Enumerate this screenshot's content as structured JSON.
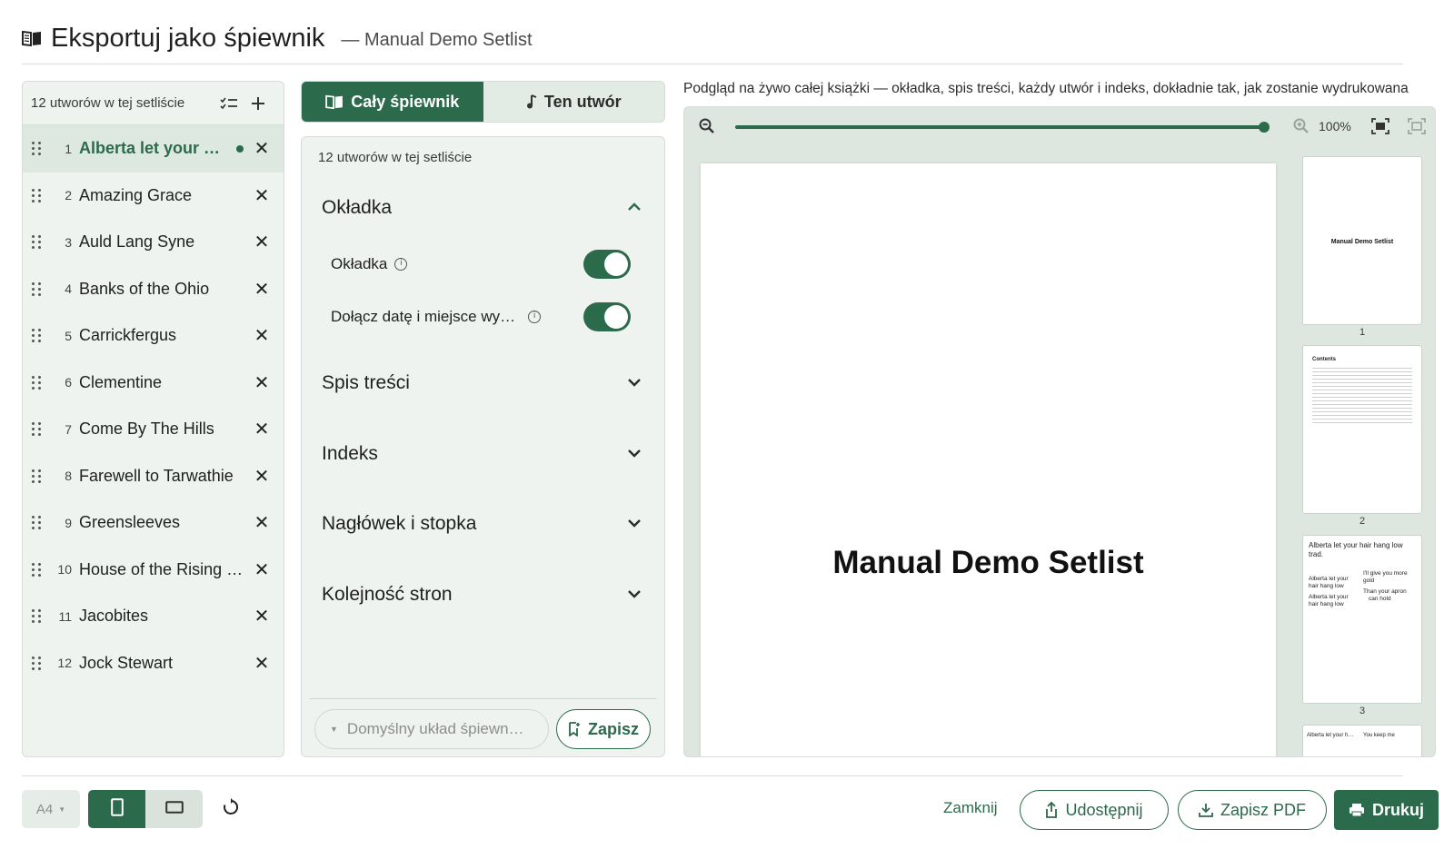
{
  "header": {
    "title": "Eksportuj jako śpiewnik",
    "subtitle": "— Manual Demo Setlist"
  },
  "setlist": {
    "count_label": "12 utworów w tej setliście",
    "songs": [
      {
        "num": "1",
        "name": "Alberta let your hair hang low",
        "active": true
      },
      {
        "num": "2",
        "name": "Amazing Grace"
      },
      {
        "num": "3",
        "name": "Auld Lang Syne"
      },
      {
        "num": "4",
        "name": "Banks of the Ohio"
      },
      {
        "num": "5",
        "name": "Carrickfergus"
      },
      {
        "num": "6",
        "name": "Clementine"
      },
      {
        "num": "7",
        "name": "Come By The Hills"
      },
      {
        "num": "8",
        "name": "Farewell to Tarwathie"
      },
      {
        "num": "9",
        "name": "Greensleeves"
      },
      {
        "num": "10",
        "name": "House of the Rising Sun"
      },
      {
        "num": "11",
        "name": "Jacobites"
      },
      {
        "num": "12",
        "name": "Jock Stewart"
      }
    ]
  },
  "tabs": {
    "whole_book": "Cały śpiewnik",
    "this_song": "Ten utwór"
  },
  "settings": {
    "count_label": "12 utworów w tej setliście",
    "cover_section": "Okładka",
    "cover_toggle_label": "Okładka",
    "date_toggle_label": "Dołącz datę i miejsce wy…",
    "cover_toggle_on": true,
    "date_toggle_on": true,
    "toc_section": "Spis treści",
    "index_section": "Indeks",
    "header_footer_section": "Nagłówek i stopka",
    "page_order_section": "Kolejność stron",
    "layout_placeholder": "Domyślny układ śpiewn…",
    "save_label": "Zapisz"
  },
  "preview": {
    "caption": "Podgląd na żywo całej książki — okładka, spis treści, każdy utwór i indeks, dokładnie tak, jak zostanie wydrukowana",
    "zoom_label": "100%",
    "zoom_level": 1.0,
    "cover_title": "Manual Demo Setlist",
    "thumbnails": [
      {
        "num": "1",
        "title": "Manual Demo Setlist"
      },
      {
        "num": "2",
        "title": "Contents"
      },
      {
        "num": "3",
        "title": "Alberta let your hair hang low",
        "subtitle": "trad.",
        "col1": [
          "Alberta let your",
          "hair hang low",
          "Alberta let your",
          "hair hang low"
        ],
        "col2": [
          "I'll give you more",
          "gold",
          "Than your apron",
          "can hold"
        ]
      },
      {
        "num": "4",
        "left": "Alberta let your h…",
        "right": "You keep me"
      }
    ]
  },
  "bottom": {
    "paper_size": "A4",
    "close_label": "Zamknij",
    "share_label": "Udostępnij",
    "save_pdf_label": "Zapisz PDF",
    "print_label": "Drukuj"
  },
  "colors": {
    "accent": "#2b6a4a",
    "panel_bg": "#eff3f0",
    "preview_bg": "#dde6df"
  },
  "icons": [
    "book-icon",
    "checklist-icon",
    "plus-icon",
    "grip-icon",
    "close-icon",
    "music-note-icon",
    "chevron-up-icon",
    "chevron-down-icon",
    "info-icon",
    "bookmark-add-icon",
    "zoom-out-icon",
    "zoom-in-icon",
    "fit-page-icon",
    "fit-width-icon",
    "portrait-icon",
    "landscape-icon",
    "reset-icon",
    "share-icon",
    "download-icon",
    "printer-icon"
  ]
}
